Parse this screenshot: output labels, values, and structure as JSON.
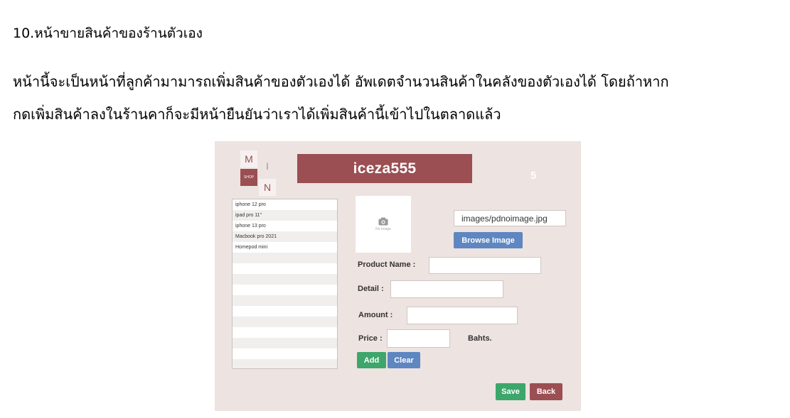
{
  "heading": "10.หน้าขายสินค้าของร้านตัวเอง",
  "paragraph_lines": [
    "หน้านี้จะเป็นหน้าที่ลูกค้ามามารถเพิ่มสินค้าของตัวเองได้ อัพเดตจำนวนสินค้าในคลังของตัวเองได้ โดยถ้าหาก",
    "กดเพิ่มสินค้าลงในร้านคาก็จะมีหน้ายืนยันว่าเราได้เพิ่มสินค้านี้เข้าไปในตลาดแล้ว"
  ],
  "app": {
    "logo": {
      "m": "M",
      "i": "I",
      "shop": "SHOP",
      "n": "N"
    },
    "store_name": "iceza555",
    "product_count": "5",
    "products": [
      "iphone 12 pro",
      "ipad pro 11\"",
      "iphone 13 pro",
      "Macbook pro 2021",
      "Homepod mini"
    ],
    "image_placeholder": "No Image",
    "image_path": "images/pdnoimage.jpg",
    "browse_label": "Browse Image",
    "product_name_label": "Product Name :",
    "detail_label": "Detail :",
    "amount_label": "Amount :",
    "price_label": "Price :",
    "price_unit": "Bahts.",
    "add_label": "Add",
    "clear_label": "Clear",
    "save_label": "Save",
    "back_label": "Back",
    "colors": {
      "brand": "#9b4f53",
      "blue": "#5e86c1",
      "green": "#3da66b",
      "panel": "#ede3e0"
    }
  }
}
